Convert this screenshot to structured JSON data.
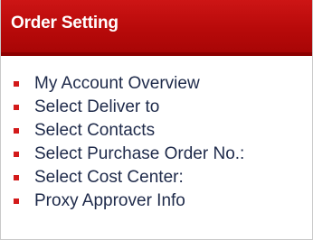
{
  "panel": {
    "title": "Order Setting"
  },
  "menu": {
    "items": [
      {
        "label": "My Account Overview"
      },
      {
        "label": "Select Deliver to"
      },
      {
        "label": "Select Contacts"
      },
      {
        "label": "Select Purchase Order No.:"
      },
      {
        "label": "Select Cost Center:"
      },
      {
        "label": "Proxy Approver Info"
      }
    ],
    "bullet_color": "#d31a1a"
  },
  "colors": {
    "header_background": "#bb0c0c",
    "header_text": "#ffffff",
    "link_text": "#1e2a4a"
  }
}
